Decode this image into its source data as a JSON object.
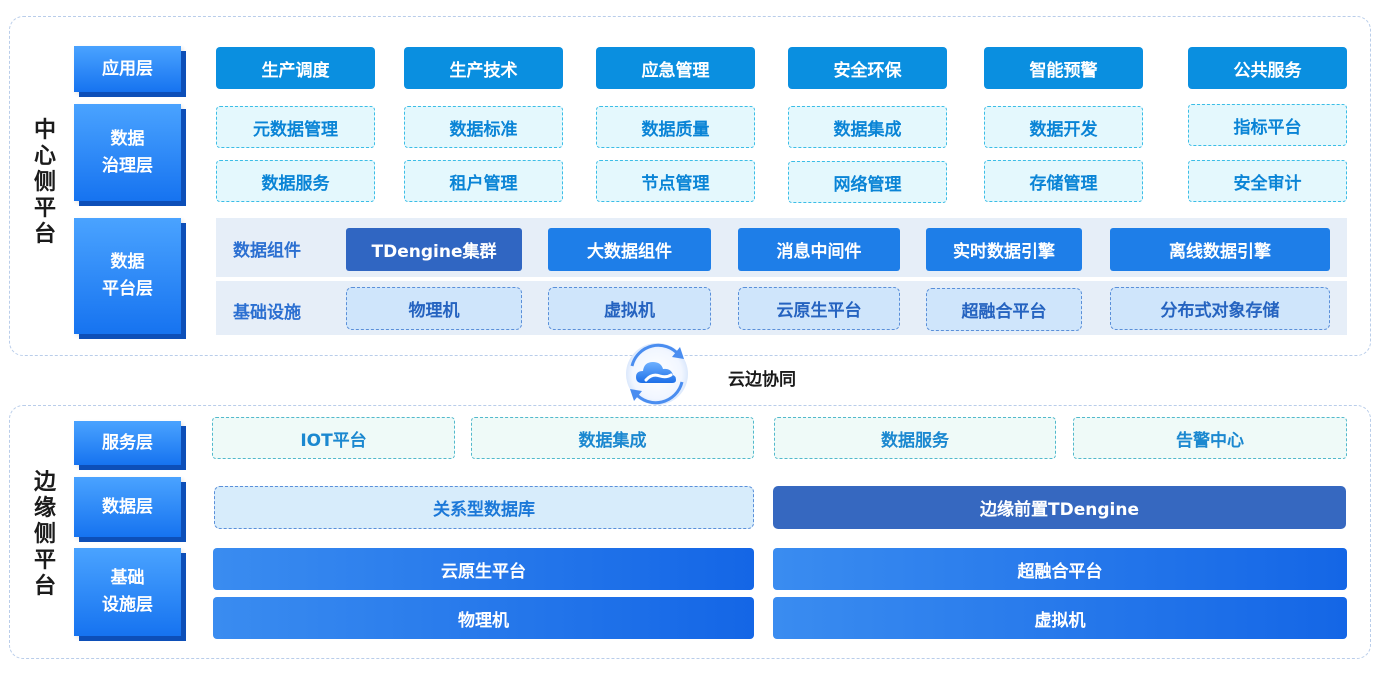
{
  "center": {
    "title_chars": [
      "中",
      "心",
      "侧",
      "平",
      "台"
    ],
    "layers": {
      "application": "应用层",
      "governance": [
        "数据",
        "治理层"
      ],
      "platform": [
        "数据",
        "平台层"
      ]
    },
    "app_items": [
      "生产调度",
      "生产技术",
      "应急管理",
      "安全环保",
      "智能预警",
      "公共服务"
    ],
    "gov_row1": [
      "元数据管理",
      "数据标准",
      "数据质量",
      "数据集成",
      "数据开发",
      "指标平台"
    ],
    "gov_row2": [
      "数据服务",
      "租户管理",
      "节点管理",
      "网络管理",
      "存储管理",
      "安全审计"
    ],
    "components_label": "数据组件",
    "components": [
      "TDengine集群",
      "大数据组件",
      "消息中间件",
      "实时数据引擎",
      "离线数据引擎"
    ],
    "infra_label": "基础设施",
    "infra": [
      "物理机",
      "虚拟机",
      "云原生平台",
      "超融合平台",
      "分布式对象存储"
    ]
  },
  "sync": {
    "label": "云边协同",
    "icon": "cloud-sync-icon",
    "colors": {
      "ring": "#4a8df0",
      "cloud_top": "#6fb1ff",
      "cloud_bottom": "#1d6fe8"
    }
  },
  "edge": {
    "title_chars": [
      "边",
      "缘",
      "侧",
      "平",
      "台"
    ],
    "layers": {
      "service": "服务层",
      "data": "数据层",
      "infrastructure": [
        "基础",
        "设施层"
      ]
    },
    "services": [
      "IOT平台",
      "数据集成",
      "数据服务",
      "告警中心"
    ],
    "relational_db": "关系型数据库",
    "edge_tdengine": "边缘前置TDengine",
    "infra_row1": [
      "云原生平台",
      "超融合平台"
    ],
    "infra_row2": [
      "物理机",
      "虚拟机"
    ]
  }
}
